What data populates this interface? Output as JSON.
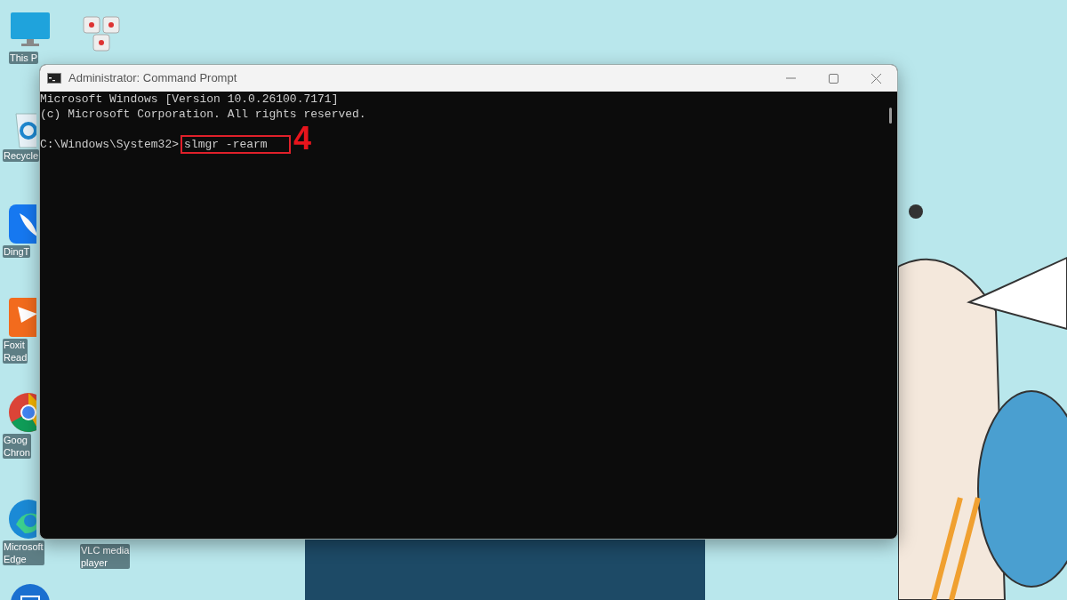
{
  "desktop_icons": [
    {
      "kind": "monitor",
      "label": "This P"
    },
    {
      "kind": "keys"
    },
    {
      "kind": "recycle-bin",
      "label": "Recycle"
    },
    {
      "kind": "bird",
      "label": "DingT"
    },
    {
      "kind": "foxit",
      "label": "Foxit\nRead"
    },
    {
      "kind": "chrome",
      "label": "Goog\nChron"
    },
    {
      "kind": "edge",
      "label": "Microsoft\nEdge"
    },
    {
      "kind": "hidden",
      "label": "VLC media\nplayer"
    },
    {
      "kind": "mail"
    }
  ],
  "window": {
    "title": "Administrator: Command Prompt",
    "console_lines": [
      {
        "kind": "output",
        "text": "Microsoft Windows [Version 10.0.26100.7171]"
      },
      {
        "kind": "output",
        "text": "(c) Microsoft Corporation. All rights reserved."
      },
      {
        "kind": "blank"
      },
      {
        "kind": "prompt",
        "prompt": "C:\\Windows\\System32>",
        "command": "slmgr -rearm",
        "highlighted": true
      }
    ]
  },
  "annotation": {
    "label": "4"
  }
}
